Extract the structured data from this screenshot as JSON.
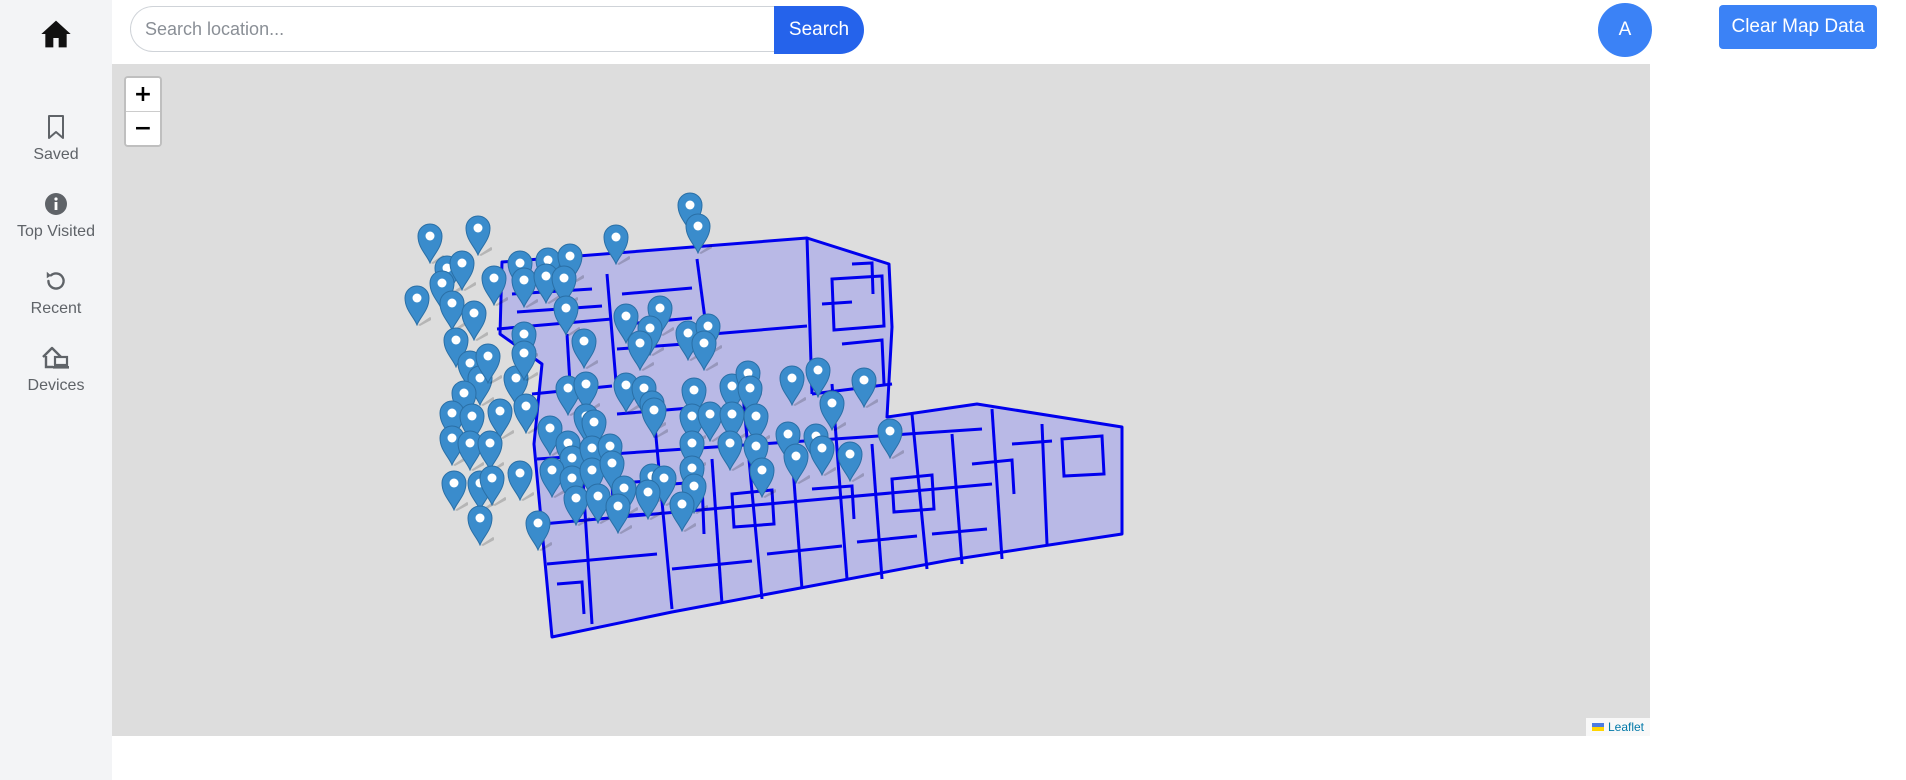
{
  "nav": {
    "items": [
      {
        "label": "Saved",
        "icon": "bookmark-icon"
      },
      {
        "label": "Top Visited",
        "icon": "info-icon"
      },
      {
        "label": "Recent",
        "icon": "history-icon"
      },
      {
        "label": "Devices",
        "icon": "devices-icon"
      }
    ]
  },
  "search": {
    "placeholder": "Search location...",
    "value": "",
    "button_label": "Search"
  },
  "user": {
    "avatar_initial": "A"
  },
  "toolbar": {
    "clear_label": "Clear Map Data"
  },
  "map": {
    "zoom_in_label": "+",
    "zoom_out_label": "−",
    "attribution": "Leaflet"
  },
  "colors": {
    "primary": "#2563eb",
    "accent": "#3b82f6",
    "map_background": "#dddddd",
    "floorplan_stroke": "#0000ee",
    "floorplan_fill": "#b3b3e8",
    "marker": "#3a8ccc"
  }
}
